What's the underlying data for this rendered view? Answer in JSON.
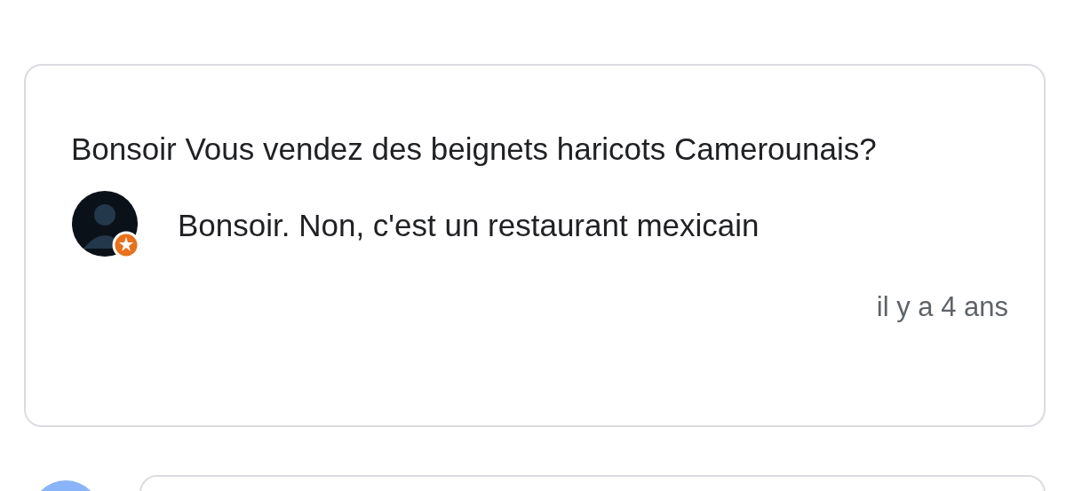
{
  "question": {
    "text": "Bonsoir Vous vendez des beignets haricots Camerounais?",
    "answer": {
      "text": "Bonsoir. Non, c'est un restaurant mexicain",
      "time": "il y a 4 ans"
    }
  }
}
